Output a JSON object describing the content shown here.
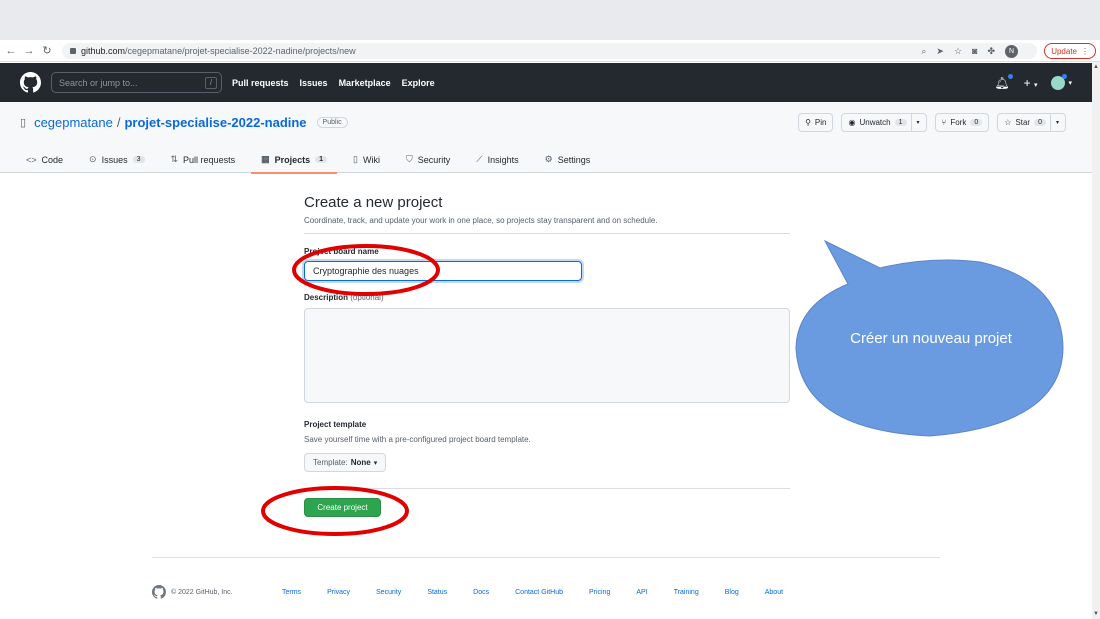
{
  "browser": {
    "url_host": "github.com",
    "url_path": "/cegepmatane/projet-specialise-2022-nadine/projects/new",
    "avatar_letter": "N",
    "update_label": "Update"
  },
  "header": {
    "search_placeholder": "Search or jump to...",
    "search_key": "/",
    "nav": [
      "Pull requests",
      "Issues",
      "Marketplace",
      "Explore"
    ]
  },
  "repo": {
    "owner": "cegepmatane",
    "separator": "/",
    "name": "projet-specialise-2022-nadine",
    "visibility": "Public",
    "actions": {
      "pin": "Pin",
      "unwatch": "Unwatch",
      "unwatch_count": "1",
      "fork": "Fork",
      "fork_count": "0",
      "star": "Star",
      "star_count": "0"
    },
    "tabs": [
      {
        "label": "Code",
        "icon": "code-icon",
        "glyph": "<>",
        "count": ""
      },
      {
        "label": "Issues",
        "icon": "issue-icon",
        "glyph": "⊙",
        "count": "3"
      },
      {
        "label": "Pull requests",
        "icon": "pull-request-icon",
        "glyph": "⇅",
        "count": ""
      },
      {
        "label": "Projects",
        "icon": "project-icon",
        "glyph": "▦",
        "count": "1"
      },
      {
        "label": "Wiki",
        "icon": "book-icon",
        "glyph": "▯",
        "count": ""
      },
      {
        "label": "Security",
        "icon": "shield-icon",
        "glyph": "⛉",
        "count": ""
      },
      {
        "label": "Insights",
        "icon": "graph-icon",
        "glyph": "⟋",
        "count": ""
      },
      {
        "label": "Settings",
        "icon": "gear-icon",
        "glyph": "⚙",
        "count": ""
      }
    ]
  },
  "form": {
    "title": "Create a new project",
    "subtitle": "Coordinate, track, and update your work in one place, so projects stay transparent and on schedule.",
    "name_label": "Project board name",
    "name_value": "Cryptographie des nuages",
    "description_label": "Description",
    "description_optional": "(optional)",
    "template_label": "Project template",
    "template_help": "Save yourself time with a pre-configured project board template.",
    "template_prefix": "Template:",
    "template_value": "None",
    "submit_label": "Create project"
  },
  "annotation": {
    "callout_text": "Créer un nouveau projet",
    "callout_color": "#6a9be0",
    "circle_color": "#e00000"
  },
  "footer": {
    "copyright": "© 2022 GitHub, Inc.",
    "links": [
      "Terms",
      "Privacy",
      "Security",
      "Status",
      "Docs",
      "Contact GitHub",
      "Pricing",
      "API",
      "Training",
      "Blog",
      "About"
    ]
  }
}
